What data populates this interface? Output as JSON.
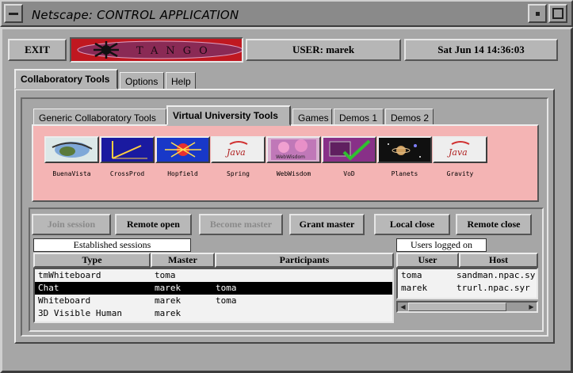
{
  "window": {
    "title": "Netscape: CONTROL APPLICATION"
  },
  "top": {
    "exit_label": "EXIT",
    "logo_text": "TANGO",
    "user": "USER: marek",
    "datetime": "Sat Jun 14 14:36:03"
  },
  "main_tabs": [
    {
      "label": "Collaboratory Tools"
    },
    {
      "label": "Options"
    },
    {
      "label": "Help"
    }
  ],
  "sub_tabs": [
    {
      "label": "Generic Collaboratory Tools"
    },
    {
      "label": "Virtual University Tools"
    },
    {
      "label": "Games"
    },
    {
      "label": "Demos 1"
    },
    {
      "label": "Demos 2"
    }
  ],
  "tools": [
    {
      "label": "BuenaVista",
      "icon": "buenavista-icon"
    },
    {
      "label": "CrossProd",
      "icon": "crossprod-icon"
    },
    {
      "label": "Hopfield",
      "icon": "hopfield-icon"
    },
    {
      "label": "Spring",
      "icon": "java-spring-icon",
      "text": "Java"
    },
    {
      "label": "WebWisdom",
      "icon": "webwisdom-icon",
      "text": "WebWisdom"
    },
    {
      "label": "VoD",
      "icon": "vod-icon"
    },
    {
      "label": "Planets",
      "icon": "planets-icon"
    },
    {
      "label": "Gravity",
      "icon": "java-gravity-icon",
      "text": "Java"
    }
  ],
  "actions": [
    {
      "label": "Join session",
      "enabled": false
    },
    {
      "label": "Remote open",
      "enabled": true
    },
    {
      "label": "Become master",
      "enabled": false
    },
    {
      "label": "Grant master",
      "enabled": true
    },
    {
      "label": "Local close",
      "enabled": true
    },
    {
      "label": "Remote close",
      "enabled": true
    }
  ],
  "sessions": {
    "title": "Established sessions",
    "columns": [
      "Type",
      "Master",
      "Participants"
    ],
    "rows": [
      {
        "type": "tmWhiteboard",
        "master": "toma",
        "participants": "",
        "selected": false
      },
      {
        "type": "Chat",
        "master": "marek",
        "participants": "toma",
        "selected": true
      },
      {
        "type": "Whiteboard",
        "master": "marek",
        "participants": "toma",
        "selected": false
      },
      {
        "type": "3D Visible Human",
        "master": "marek",
        "participants": "",
        "selected": false
      }
    ]
  },
  "users": {
    "title": "Users logged on",
    "columns": [
      "User",
      "Host"
    ],
    "rows": [
      {
        "user": "toma",
        "host": "sandman.npac.sy"
      },
      {
        "user": "marek",
        "host": "trurl.npac.syr"
      }
    ]
  },
  "colors": {
    "tools_panel": "#f4b4b4",
    "logo_bg": "#c01820",
    "selected_row": "#000000"
  }
}
